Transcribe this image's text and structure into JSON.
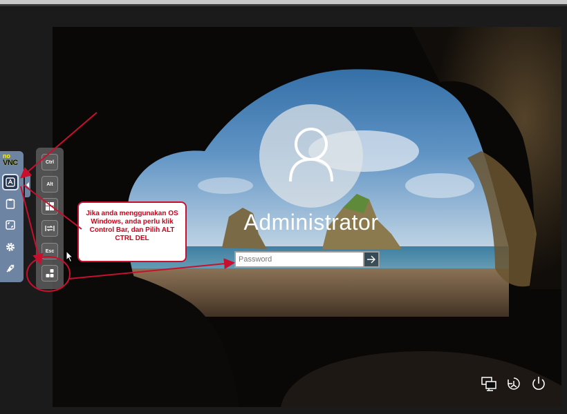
{
  "login": {
    "username": "Administrator",
    "password_placeholder": "Password"
  },
  "annotation": {
    "text": "Jika anda menggunakan OS Windows, anda perlu klik Control Bar, dan Pilih ALT CTRL DEL"
  },
  "novnc": {
    "logo_top": "no",
    "logo_bottom": "VNC",
    "buttons": [
      "keyboard-icon",
      "clipboard-icon",
      "fullscreen-icon",
      "settings-icon",
      "disconnect-icon"
    ]
  },
  "extra_keys": {
    "ctrl": "Ctrl",
    "alt": "Alt",
    "windows": "windows-icon",
    "tab": "tab-icon",
    "esc": "Esc",
    "ctrl_alt_del": "ctrl-alt-del-icon"
  },
  "system_icons": [
    "network-icon",
    "ease-of-access-icon",
    "power-icon"
  ],
  "colors": {
    "annotation_red": "#c8102e",
    "novnc_bar": "#6e84a3"
  }
}
